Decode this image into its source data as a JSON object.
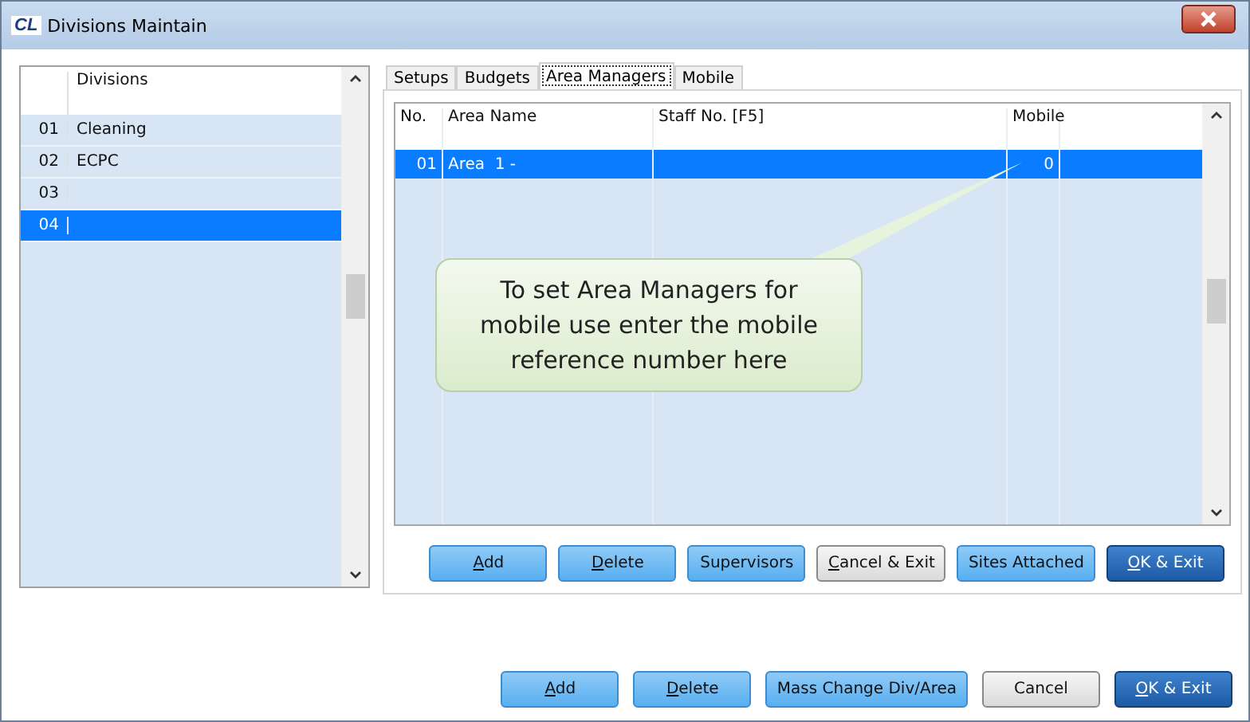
{
  "window": {
    "title": "Divisions Maintain",
    "logo": "CL"
  },
  "divisions": {
    "header": "Divisions",
    "rows": [
      {
        "no": "01",
        "name": "Cleaning",
        "selected": false
      },
      {
        "no": "02",
        "name": "ECPC",
        "selected": false
      },
      {
        "no": "03",
        "name": "",
        "selected": false
      },
      {
        "no": "04",
        "name": "",
        "selected": true
      }
    ]
  },
  "tabs": [
    {
      "label": "Setups",
      "selected": false
    },
    {
      "label": "Budgets",
      "selected": false
    },
    {
      "label": "Area Managers",
      "selected": true
    },
    {
      "label": "Mobile",
      "selected": false
    }
  ],
  "table": {
    "columns": [
      "No.",
      "Area Name",
      "Staff No. [F5]",
      "Mobile"
    ],
    "rows": [
      {
        "cells": [
          "01",
          "Area  1 -",
          "",
          "0"
        ],
        "selected": true
      }
    ]
  },
  "callout": "To set Area Managers for mobile use enter the mobile reference number here",
  "tab_buttons": [
    {
      "label": "Add",
      "kind": "blue",
      "mnemonic": true
    },
    {
      "label": "Delete",
      "kind": "blue",
      "mnemonic": true
    },
    {
      "label": "Supervisors",
      "kind": "blue",
      "mnemonic": false
    },
    {
      "label": "Cancel & Exit",
      "kind": "grey",
      "mnemonic": true
    },
    {
      "label": "Sites Attached",
      "kind": "blue",
      "mnemonic": false
    },
    {
      "label": "OK & Exit",
      "kind": "dark",
      "mnemonic": true
    }
  ],
  "buttons": [
    {
      "label": "Add",
      "kind": "blue",
      "mnemonic": true
    },
    {
      "label": "Delete",
      "kind": "blue",
      "mnemonic": true
    },
    {
      "label": "Mass Change Div/Area",
      "kind": "blue",
      "mnemonic": false
    },
    {
      "label": "Cancel",
      "kind": "grey",
      "mnemonic": false
    },
    {
      "label": "OK & Exit",
      "kind": "dark",
      "mnemonic": true
    }
  ]
}
